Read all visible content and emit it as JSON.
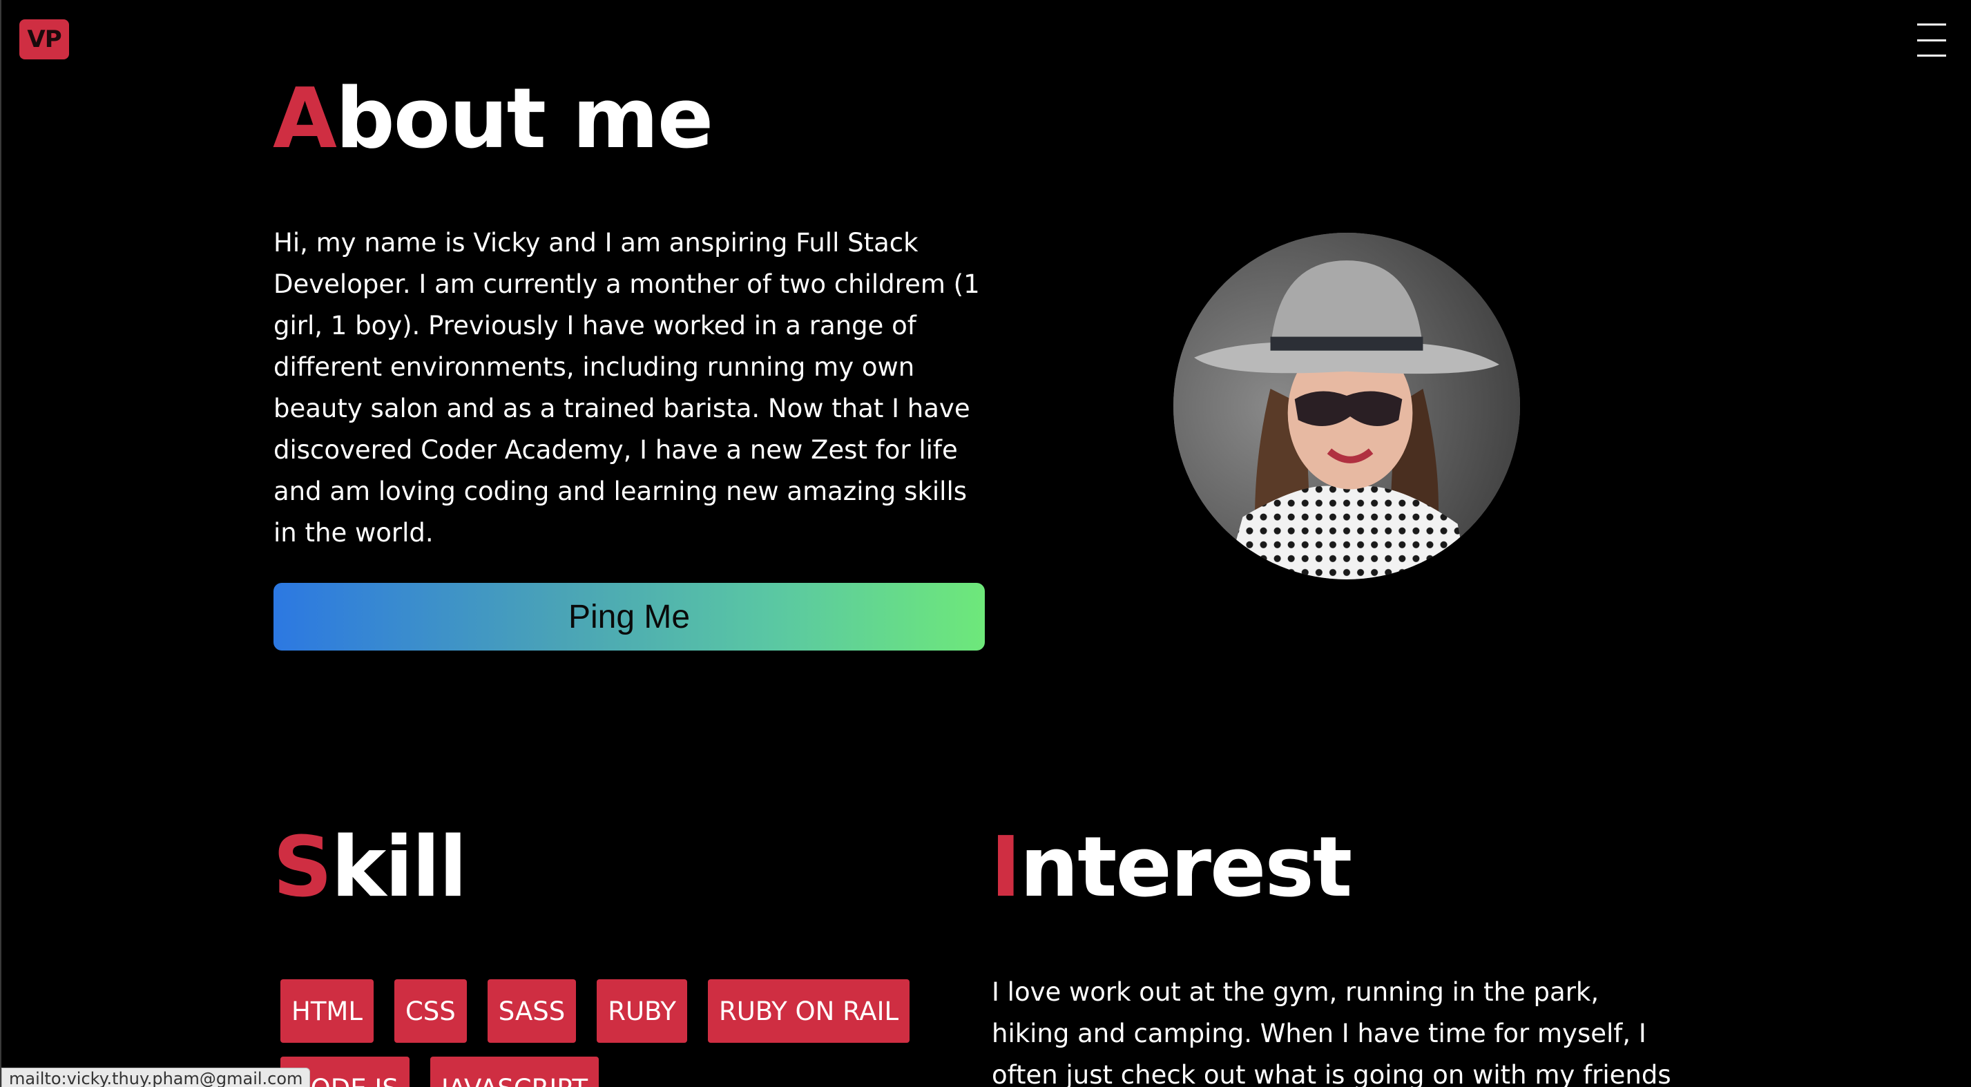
{
  "header": {
    "logo_text": "VP",
    "menu_icon": "hamburger-menu-icon"
  },
  "about": {
    "title_first": "A",
    "title_rest": "bout me",
    "text": "Hi, my name is Vicky and I am anspiring Full Stack Developer. I am currently a monther of two childrem (1 girl, 1 boy). Previously I have worked in a range of different environments, including running my own beauty salon and as a trained barista. Now that I have discovered Coder Academy, I have a new Zest for life and am loving coding and learning new amazing skills in the world.",
    "button_label": "Ping Me"
  },
  "skill": {
    "title_first": "S",
    "title_rest": "kill",
    "tags": [
      "HTML",
      "CSS",
      "SASS",
      "RUBY",
      "RUBY ON RAIL",
      "NODE JS",
      "JAVASCRIPT"
    ]
  },
  "interest": {
    "title_first": "I",
    "title_rest": "nterest",
    "text": "I love work out at the gym, running in the park, hiking and camping. When I have time for myself, I often just check out what is going on with my friends and family."
  },
  "status_bar": {
    "text": "mailto:vicky.thuy.pham@gmail.com"
  },
  "colors": {
    "accent": "#cf2e42",
    "background": "#000000",
    "button_gradient_start": "#2c78e2",
    "button_gradient_end": "#6ee87a"
  }
}
